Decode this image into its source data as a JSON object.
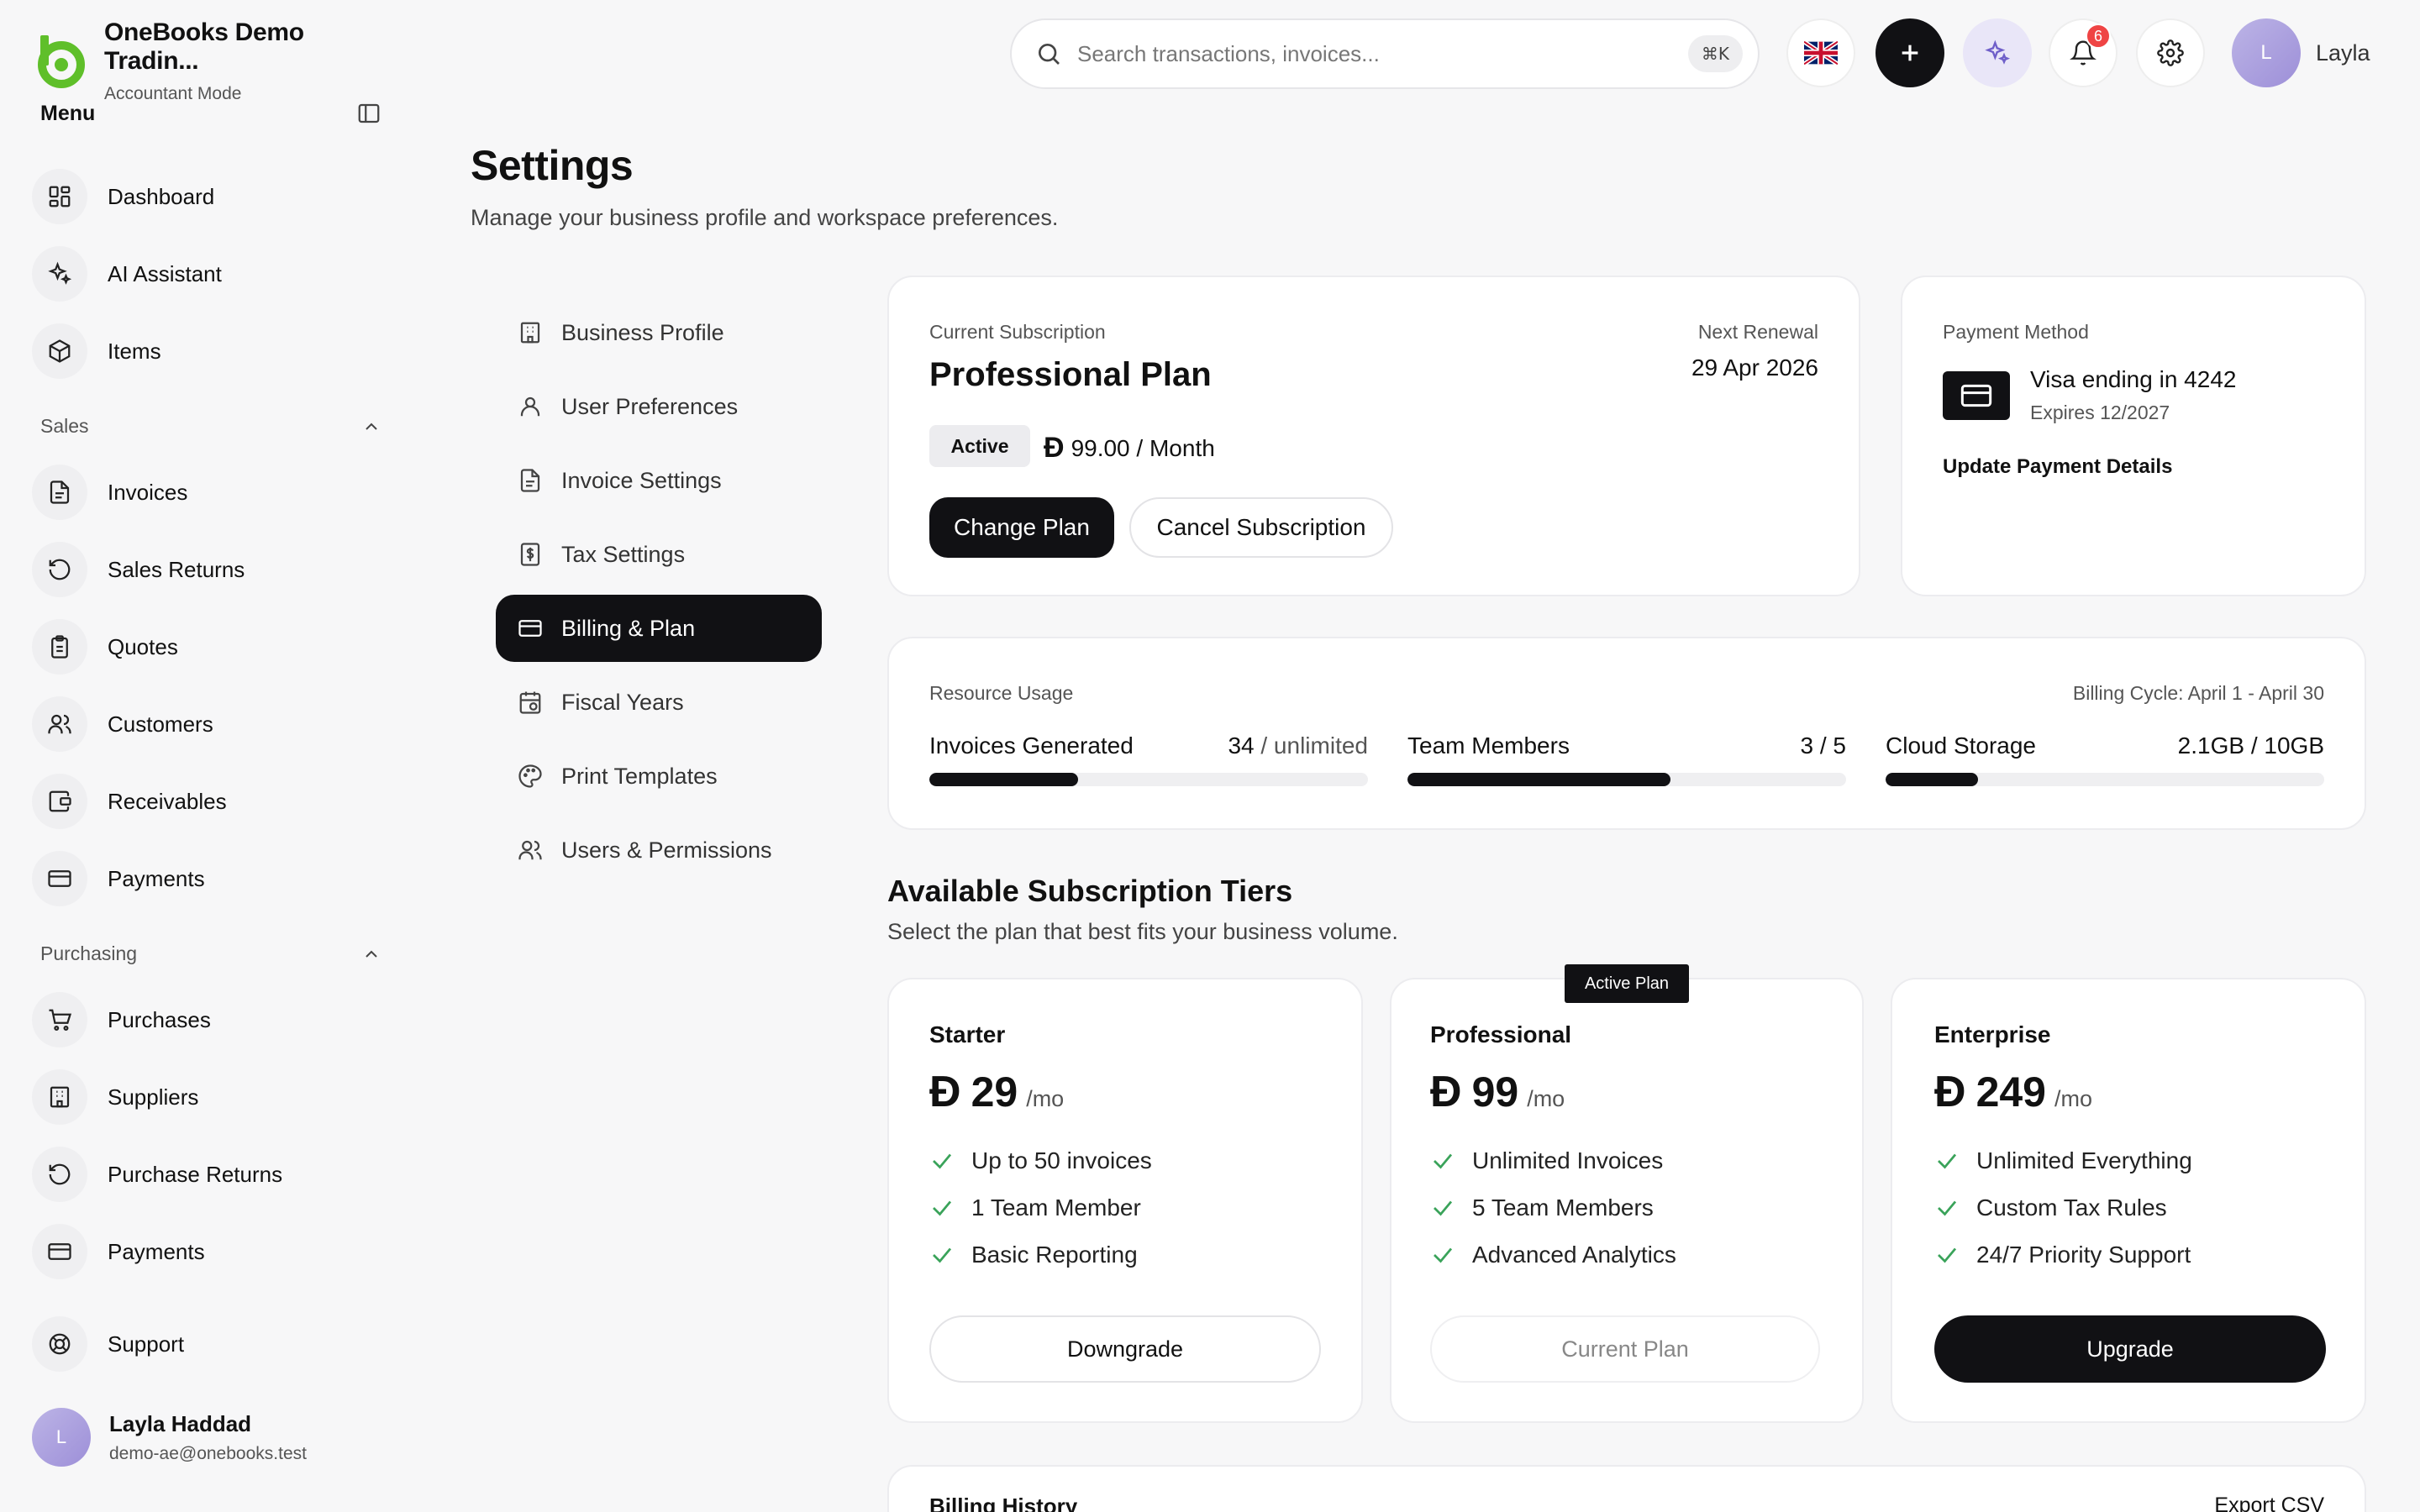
{
  "brand": {
    "name": "OneBooks Demo Tradin...",
    "mode": "Accountant Mode",
    "color": "#5fbf2a"
  },
  "sidebar": {
    "menu_title": "Menu",
    "top_items": [
      {
        "label": "Dashboard",
        "icon": "dashboard-icon"
      },
      {
        "label": "AI Assistant",
        "icon": "sparkles-icon"
      },
      {
        "label": "Items",
        "icon": "package-icon"
      }
    ],
    "sales": {
      "title": "Sales",
      "items": [
        {
          "label": "Invoices",
          "icon": "document-icon"
        },
        {
          "label": "Sales Returns",
          "icon": "rotate-ccw-icon"
        },
        {
          "label": "Quotes",
          "icon": "clipboard-icon"
        },
        {
          "label": "Customers",
          "icon": "users-icon"
        },
        {
          "label": "Receivables",
          "icon": "wallet-icon"
        },
        {
          "label": "Payments",
          "icon": "credit-card-icon"
        }
      ]
    },
    "purchasing": {
      "title": "Purchasing",
      "items": [
        {
          "label": "Purchases",
          "icon": "cart-icon"
        },
        {
          "label": "Suppliers",
          "icon": "building-icon"
        },
        {
          "label": "Purchase Returns",
          "icon": "rotate-ccw-icon"
        },
        {
          "label": "Payments",
          "icon": "credit-card-icon"
        }
      ]
    },
    "support": {
      "label": "Support",
      "icon": "lifebuoy-icon"
    },
    "user": {
      "initial": "L",
      "name": "Layla Haddad",
      "email": "demo-ae@onebooks.test"
    }
  },
  "topbar": {
    "search_placeholder": "Search transactions, invoices...",
    "shortcut": "⌘K",
    "notification_count": "6",
    "user_initial": "L",
    "user_name": "Layla"
  },
  "page": {
    "title": "Settings",
    "subtitle": "Manage your business profile and workspace preferences."
  },
  "settings_nav": [
    {
      "label": "Business Profile",
      "icon": "building-icon",
      "active": false
    },
    {
      "label": "User Preferences",
      "icon": "user-icon",
      "active": false
    },
    {
      "label": "Invoice Settings",
      "icon": "document-icon",
      "active": false
    },
    {
      "label": "Tax Settings",
      "icon": "receipt-icon",
      "active": false
    },
    {
      "label": "Billing & Plan",
      "icon": "credit-card-icon",
      "active": true
    },
    {
      "label": "Fiscal Years",
      "icon": "calendar-icon",
      "active": false
    },
    {
      "label": "Print Templates",
      "icon": "palette-icon",
      "active": false
    },
    {
      "label": "Users & Permissions",
      "icon": "users-icon",
      "active": false
    }
  ],
  "subscription": {
    "label": "Current Subscription",
    "plan": "Professional Plan",
    "renewal_label": "Next Renewal",
    "renewal_date": "29 Apr 2026",
    "status": "Active",
    "currency": "Đ",
    "price": "99.00 / Month",
    "change_label": "Change Plan",
    "cancel_label": "Cancel Subscription"
  },
  "payment": {
    "label": "Payment Method",
    "card": "Visa ending in 4242",
    "expires": "Expires 12/2027",
    "update_label": "Update Payment Details"
  },
  "usage": {
    "title": "Resource Usage",
    "cycle": "Billing Cycle: April 1 - April 30",
    "items": [
      {
        "label": "Invoices Generated",
        "value": "34",
        "limit": "/ unlimited",
        "fill": 0.34
      },
      {
        "label": "Team Members",
        "value": "3 / 5",
        "limit": "",
        "fill": 0.6
      },
      {
        "label": "Cloud Storage",
        "value": "2.1GB / 10GB",
        "limit": "",
        "fill": 0.21
      }
    ]
  },
  "tiers": {
    "title": "Available Subscription Tiers",
    "subtitle": "Select the plan that best fits your business volume.",
    "active_tag": "Active Plan",
    "currency": "Đ",
    "period": "/mo",
    "plans": [
      {
        "name": "Starter",
        "price": "29",
        "features": [
          "Up to 50 invoices",
          "1 Team Member",
          "Basic Reporting"
        ],
        "button": "Downgrade",
        "style": "outline"
      },
      {
        "name": "Professional",
        "price": "99",
        "features": [
          "Unlimited Invoices",
          "5 Team Members",
          "Advanced Analytics"
        ],
        "button": "Current Plan",
        "style": "disabled"
      },
      {
        "name": "Enterprise",
        "price": "249",
        "features": [
          "Unlimited Everything",
          "Custom Tax Rules",
          "24/7 Priority Support"
        ],
        "button": "Upgrade",
        "style": "dark"
      }
    ]
  },
  "history": {
    "title": "Billing History",
    "export_label": "Export CSV"
  },
  "colors": {
    "accent": "#111114",
    "check": "#3aa35a",
    "badge": "#ef4444",
    "ai_bg": "#e9e6f8"
  }
}
